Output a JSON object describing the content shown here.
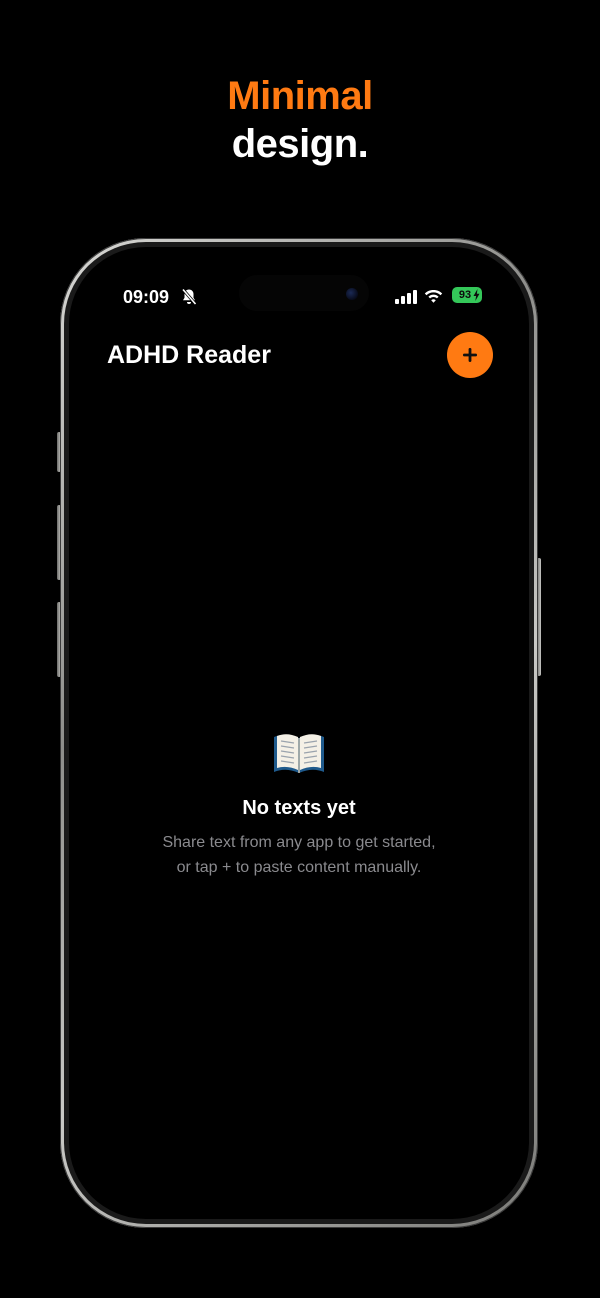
{
  "headline": {
    "accent": "Minimal",
    "plain": "design."
  },
  "status_bar": {
    "time": "09:09",
    "battery": "93"
  },
  "app": {
    "title": "ADHD Reader",
    "add_button_label": "+"
  },
  "empty_state": {
    "title": "No texts yet",
    "line1": "Share text from any app to get started,",
    "line2": "or tap + to paste content manually."
  },
  "colors": {
    "accent": "#ff7a12",
    "battery": "#34c759",
    "muted_text": "#8a8a8e"
  }
}
